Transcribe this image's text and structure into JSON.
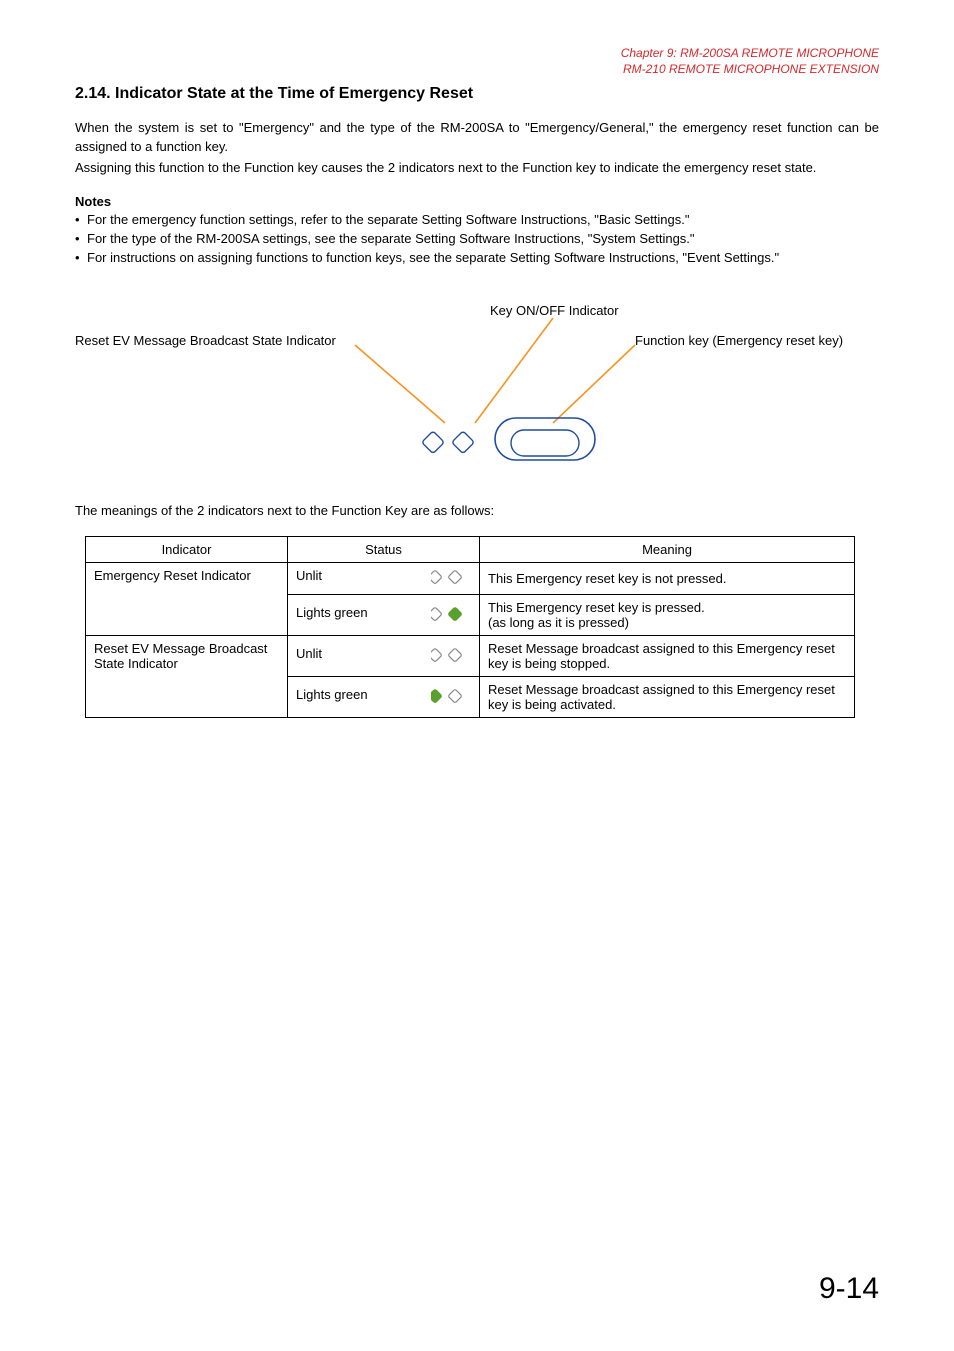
{
  "chapter": {
    "line1": "Chapter 9: RM-200SA REMOTE MICROPHONE",
    "line2": "RM-210 REMOTE MICROPHONE EXTENSION"
  },
  "section": {
    "title": "2.14. Indicator State at the Time of Emergency Reset",
    "para1": "When the system is set to \"Emergency\" and the type of the RM-200SA to \"Emergency/General,\" the emergency reset function can be assigned to a function key.",
    "para2": "Assigning this function to the Function key causes the 2 indicators next to the Function key to indicate the emergency reset state."
  },
  "notes": {
    "heading": "Notes",
    "items": [
      "For the emergency function settings, refer to the separate Setting Software Instructions, \"Basic Settings.\"",
      "For the type of the RM-200SA settings, see the separate Setting Software Instructions, \"System Settings.\"",
      "For instructions on assigning functions to function keys, see the separate Setting Software Instructions, \"Event Settings.\""
    ]
  },
  "diagram": {
    "label_top": "Key ON/OFF Indicator",
    "label_left": "Reset EV Message Broadcast State Indicator",
    "label_right": "Function key (Emergency reset key)"
  },
  "meaning_intro": "The meanings of the 2 indicators next to the Function Key are as follows:",
  "table": {
    "headers": {
      "c1": "Indicator",
      "c2": "Status",
      "c3": "Meaning"
    },
    "rows": [
      {
        "indicator": "Emergency Reset Indicator",
        "status": "Unlit",
        "left_green": false,
        "right_green": false,
        "meaning": "This Emergency reset key is not pressed."
      },
      {
        "indicator": "",
        "status": "Lights green",
        "left_green": false,
        "right_green": true,
        "meaning": "This Emergency reset key is pressed.\n(as long as it is pressed)"
      },
      {
        "indicator": "Reset EV Message Broadcast State Indicator",
        "status": "Unlit",
        "left_green": false,
        "right_green": false,
        "meaning": "Reset Message broadcast assigned to this Emergency reset key is being stopped."
      },
      {
        "indicator": "",
        "status": "Lights green",
        "left_green": true,
        "right_green": false,
        "meaning": "Reset Message broadcast assigned to this Emergency reset key is being activated."
      }
    ]
  },
  "page_number": "9-14",
  "colors": {
    "accent": "#f7931e",
    "green": "#5aa02c",
    "red": "#d8282c",
    "blue": "#1e4ca0"
  }
}
